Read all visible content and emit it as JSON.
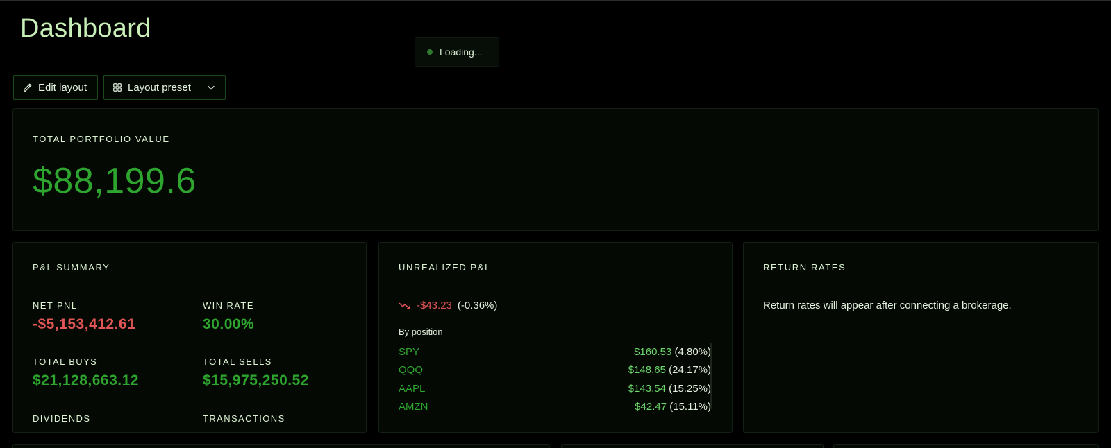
{
  "header": {
    "title": "Dashboard"
  },
  "toast": {
    "text": "Loading..."
  },
  "toolbar": {
    "edit_label": "Edit layout",
    "preset_label": "Layout preset"
  },
  "portfolio": {
    "label": "TOTAL PORTFOLIO VALUE",
    "value": "$88,199.6"
  },
  "pnl_summary": {
    "label": "P&L SUMMARY",
    "net_pnl_label": "NET PNL",
    "net_pnl_value": "-$5,153,412.61",
    "win_rate_label": "WIN RATE",
    "win_rate_value": "30.00%",
    "total_buys_label": "TOTAL BUYS",
    "total_buys_value": "$21,128,663.12",
    "total_sells_label": "TOTAL SELLS",
    "total_sells_value": "$15,975,250.52",
    "dividends_label": "DIVIDENDS",
    "transactions_label": "TRANSACTIONS"
  },
  "unrealized": {
    "label": "UNREALIZED P&L",
    "amount": "-$43.23",
    "percent": "(-0.36%)",
    "by_position_label": "By position",
    "positions": [
      {
        "symbol": "SPY",
        "value": "$160.53",
        "pct": "(4.80%)"
      },
      {
        "symbol": "QQQ",
        "value": "$148.65",
        "pct": "(24.17%)"
      },
      {
        "symbol": "AAPL",
        "value": "$143.54",
        "pct": "(15.25%)"
      },
      {
        "symbol": "AMZN",
        "value": "$42.47",
        "pct": "(15.11%)"
      }
    ]
  },
  "return_rates": {
    "label": "RETURN RATES",
    "message": "Return rates will appear after connecting a brokerage."
  },
  "colors": {
    "accent": "#2ea52e",
    "negative": "#e05555",
    "background": "#000000"
  },
  "icons": {
    "edit": "pencil-icon",
    "preset": "grid-icon",
    "dropdown": "chevron-down-icon",
    "trend": "trend-down-icon"
  }
}
